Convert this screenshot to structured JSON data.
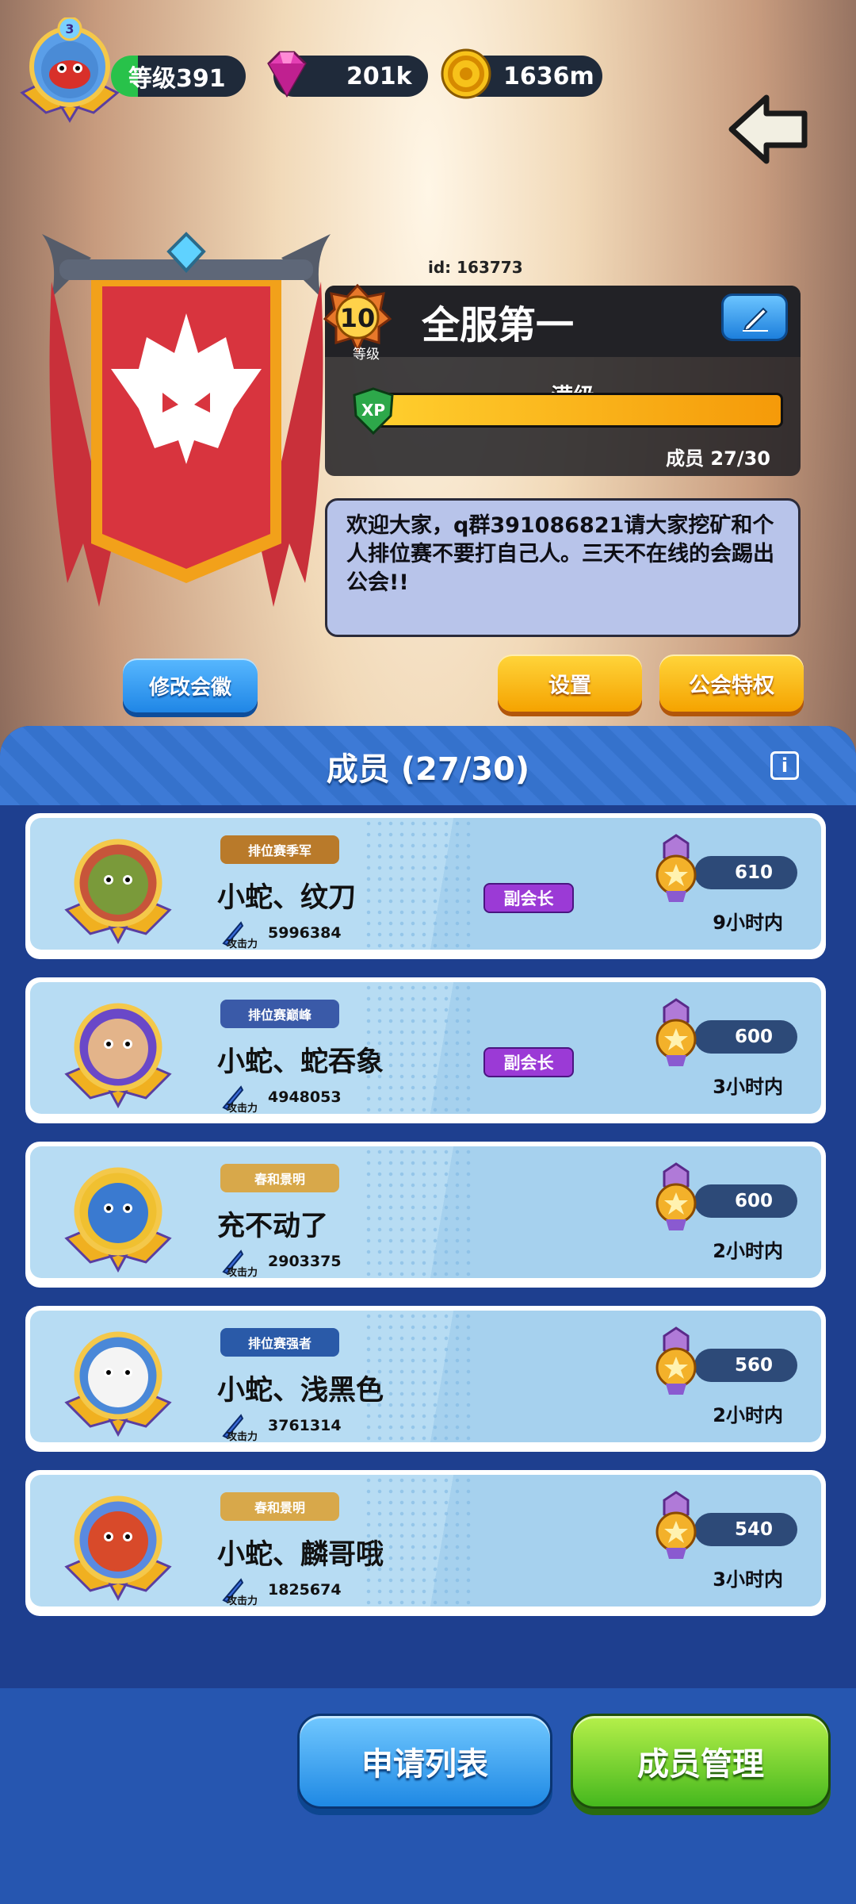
{
  "top": {
    "level_label": "等级391",
    "avatar_rank": "3",
    "gems": "201k",
    "coins": "1636m"
  },
  "guild": {
    "id": "id: 163773",
    "level": "10",
    "level_caption": "等级",
    "name": "全服第一",
    "xp_label": "满级",
    "xp_text": "XP",
    "xp_fill": 1.0,
    "members": "成员 27/30",
    "notice": "欢迎大家，q群391086821请大家挖矿和个人排位赛不要打自己人。三天不在线的会踢出公会!!",
    "edit_emblem": "修改会徽",
    "settings": "设置",
    "privilege": "公会特权"
  },
  "panel": {
    "title": "成员 (27/30)",
    "info": "i"
  },
  "members": [
    {
      "title": "排位赛季军",
      "name": "小蛇、纹刀",
      "power_label": "攻击力",
      "power": "5996384",
      "role": "副会长",
      "trophy": "610",
      "time": "9小时内"
    },
    {
      "title": "排位赛巅峰",
      "name": "小蛇、蛇吞象",
      "power_label": "攻击力",
      "power": "4948053",
      "role": "副会长",
      "trophy": "600",
      "time": "3小时内"
    },
    {
      "title": "春和景明",
      "name": "充不动了",
      "power_label": "攻击力",
      "power": "2903375",
      "role": "",
      "trophy": "600",
      "time": "2小时内"
    },
    {
      "title": "排位赛强者",
      "name": "小蛇、浅黑色",
      "power_label": "攻击力",
      "power": "3761314",
      "role": "",
      "trophy": "560",
      "time": "2小时内"
    },
    {
      "title": "春和景明",
      "name": "小蛇、麟哥哦",
      "power_label": "攻击力",
      "power": "1825674",
      "role": "",
      "trophy": "540",
      "time": "3小时内"
    }
  ],
  "bottom": {
    "apply": "申请列表",
    "manage": "成员管理"
  },
  "colors": {
    "panel": "#1e3f8f",
    "row": "#b7dcf3",
    "role_badge": "#9b3ad6",
    "accent_yellow": "#f5a300"
  }
}
